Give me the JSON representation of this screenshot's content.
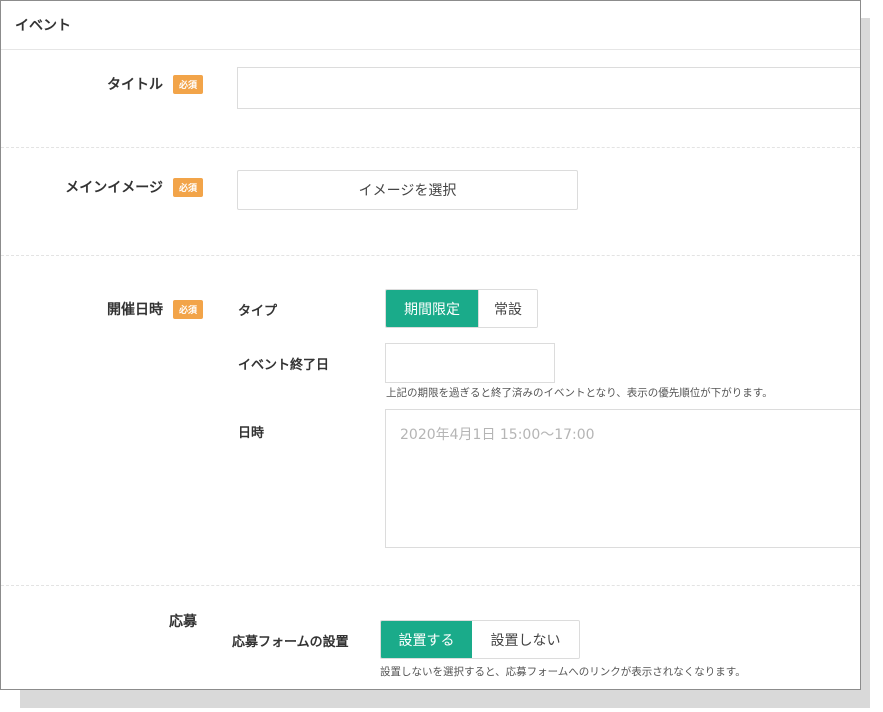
{
  "panel": {
    "title": "イベント"
  },
  "badge": {
    "required": "必須"
  },
  "fields": {
    "title": {
      "label": "タイトル",
      "value": ""
    },
    "main_image": {
      "label": "メインイメージ",
      "button": "イメージを選択"
    },
    "datetime": {
      "label": "開催日時",
      "type_label": "タイプ",
      "type_options": [
        "期間限定",
        "常設"
      ],
      "type_selected": "期間限定",
      "end_date_label": "イベント終了日",
      "end_date_value": "",
      "end_date_help": "上記の期限を過ぎると終了済みのイベントとなり、表示の優先順位が下がります。",
      "schedule_label": "日時",
      "schedule_placeholder": "2020年4月1日 15:00〜17:00"
    },
    "application": {
      "label": "応募",
      "form_label": "応募フォームの設置",
      "form_options": [
        "設置する",
        "設置しない"
      ],
      "form_selected": "設置する",
      "form_help": "設置しないを選択すると、応募フォームへのリンクが表示されなくなります。"
    }
  },
  "colors": {
    "accent": "#1aab8a",
    "required_badge": "#f2a449"
  }
}
